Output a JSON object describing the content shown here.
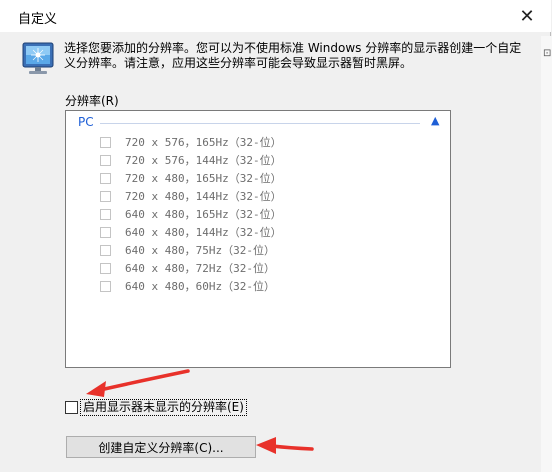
{
  "window": {
    "title": "自定义",
    "close_glyph": "✕"
  },
  "description": "选择您要添加的分辨率。您可以为不使用标准 Windows 分辨率的显示器创建一个自定义分辨率。请注意，应用这些分辨率可能会导致显示器暂时黑屏。",
  "list_label": "分辨率(R)",
  "group": {
    "name": "PC",
    "collapse_glyph": "▲"
  },
  "resolutions": [
    "720 x 576，165Hz（32-位）",
    "720 x 576，144Hz（32-位）",
    "720 x 480，165Hz（32-位）",
    "720 x 480，144Hz（32-位）",
    "640 x 480，165Hz（32-位）",
    "640 x 480，144Hz（32-位）",
    "640 x 480，75Hz（32-位）",
    "640 x 480，72Hz（32-位）",
    "640 x 480，60Hz（32-位）"
  ],
  "enable_checkbox_label": "启用显示器未显示的分辨率(E)",
  "create_button_label": "创建自定义分辨率(C)...",
  "colors": {
    "annotation_arrow": "#e8312a",
    "group_header": "#1e5fd6"
  }
}
